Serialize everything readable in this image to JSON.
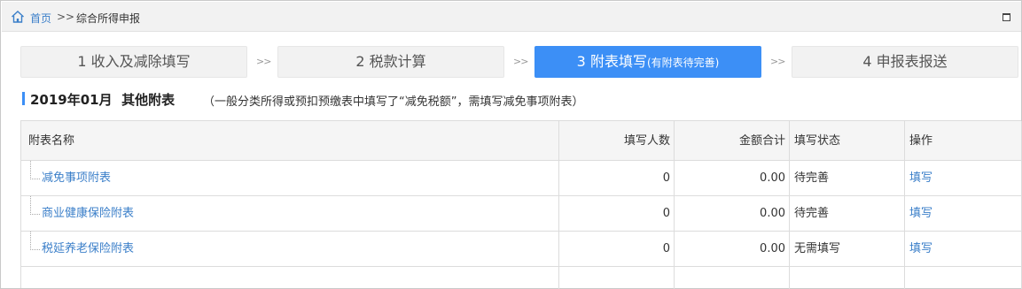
{
  "breadcrumb": {
    "home": "首页",
    "separator": ">>",
    "current": "综合所得申报"
  },
  "steps": [
    {
      "label": "1 收入及减除填写",
      "sub": "",
      "active": false
    },
    {
      "label": "2 税款计算",
      "sub": "",
      "active": false
    },
    {
      "label": "3 附表填写",
      "sub": "(有附表待完善)",
      "active": true
    },
    {
      "label": "4 申报表报送",
      "sub": "",
      "active": false
    }
  ],
  "step_separator": ">>",
  "section": {
    "title": "2019年01月  其他附表",
    "note": "（一般分类所得或预扣预缴表中填写了“减免税额”，需填写减免事项附表）"
  },
  "table": {
    "headers": {
      "name": "附表名称",
      "count": "填写人数",
      "amount": "金额合计",
      "status": "填写状态",
      "op": "操作"
    },
    "rows": [
      {
        "name": "减免事项附表",
        "count": "0",
        "amount": "0.00",
        "status": "待完善",
        "status_type": "pending",
        "op": "填写"
      },
      {
        "name": "商业健康保险附表",
        "count": "0",
        "amount": "0.00",
        "status": "待完善",
        "status_type": "pending",
        "op": "填写"
      },
      {
        "name": "税延养老保险附表",
        "count": "0",
        "amount": "0.00",
        "status": "无需填写",
        "status_type": "none",
        "op": "填写"
      }
    ]
  },
  "colors": {
    "accent": "#3c8ff6",
    "link": "#3b7fc9",
    "pending": "#e2573d"
  },
  "icons": {
    "home": "home-icon",
    "maximize": "maximize-icon"
  }
}
